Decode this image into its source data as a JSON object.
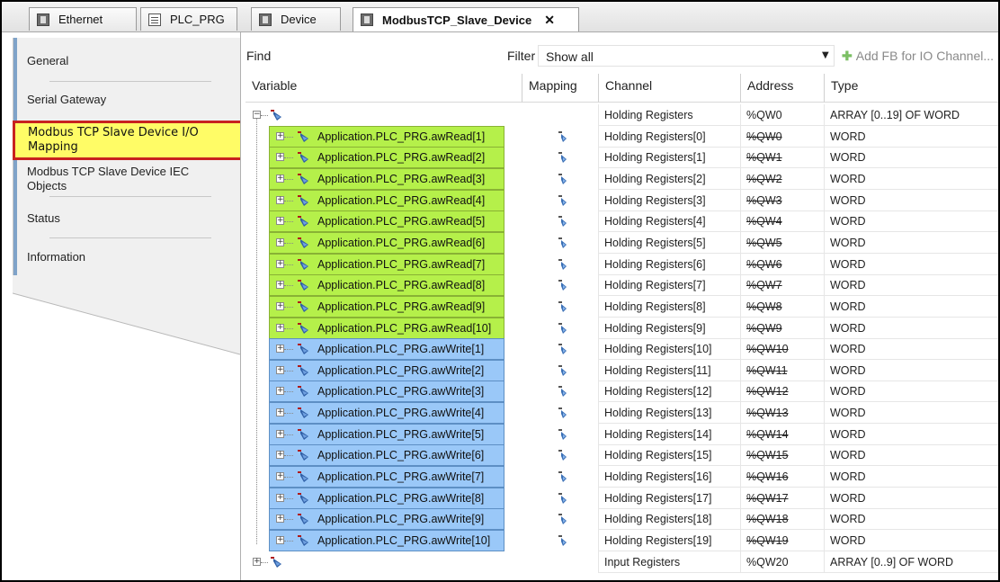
{
  "tabs": [
    {
      "label": "Ethernet",
      "icon": "device-icon"
    },
    {
      "label": "PLC_PRG",
      "icon": "document-icon"
    },
    {
      "label": "Device",
      "icon": "device-icon"
    },
    {
      "label": "ModbusTCP_Slave_Device",
      "icon": "device-icon",
      "close": "✕"
    }
  ],
  "nav": {
    "general": "General",
    "serial_gateway": "Serial Gateway",
    "io_mapping": "Modbus TCP Slave Device I/O Mapping",
    "iec_objects": "Modbus TCP Slave Device IEC Objects",
    "status": "Status",
    "information": "Information"
  },
  "toolbar": {
    "find_label": "Find",
    "filter_label": "Filter",
    "filter_value": "Show all",
    "add_fb": "Add FB for IO Channel..."
  },
  "columns": {
    "variable": "Variable",
    "mapping": "Mapping",
    "channel": "Channel",
    "address": "Address",
    "type": "Type"
  },
  "rows": [
    {
      "variable": "",
      "channel": "Holding Registers",
      "address": "%QW0",
      "type": "ARRAY [0..19] OF WORD"
    },
    {
      "variable": "Application.PLC_PRG.awRead[1]",
      "channel": "Holding Registers[0]",
      "address": "%QW0",
      "type": "WORD"
    },
    {
      "variable": "Application.PLC_PRG.awRead[2]",
      "channel": "Holding Registers[1]",
      "address": "%QW1",
      "type": "WORD"
    },
    {
      "variable": "Application.PLC_PRG.awRead[3]",
      "channel": "Holding Registers[2]",
      "address": "%QW2",
      "type": "WORD"
    },
    {
      "variable": "Application.PLC_PRG.awRead[4]",
      "channel": "Holding Registers[3]",
      "address": "%QW3",
      "type": "WORD"
    },
    {
      "variable": "Application.PLC_PRG.awRead[5]",
      "channel": "Holding Registers[4]",
      "address": "%QW4",
      "type": "WORD"
    },
    {
      "variable": "Application.PLC_PRG.awRead[6]",
      "channel": "Holding Registers[5]",
      "address": "%QW5",
      "type": "WORD"
    },
    {
      "variable": "Application.PLC_PRG.awRead[7]",
      "channel": "Holding Registers[6]",
      "address": "%QW6",
      "type": "WORD"
    },
    {
      "variable": "Application.PLC_PRG.awRead[8]",
      "channel": "Holding Registers[7]",
      "address": "%QW7",
      "type": "WORD"
    },
    {
      "variable": "Application.PLC_PRG.awRead[9]",
      "channel": "Holding Registers[8]",
      "address": "%QW8",
      "type": "WORD"
    },
    {
      "variable": "Application.PLC_PRG.awRead[10]",
      "channel": "Holding Registers[9]",
      "address": "%QW9",
      "type": "WORD"
    },
    {
      "variable": "Application.PLC_PRG.awWrite[1]",
      "channel": "Holding Registers[10]",
      "address": "%QW10",
      "type": "WORD"
    },
    {
      "variable": "Application.PLC_PRG.awWrite[2]",
      "channel": "Holding Registers[11]",
      "address": "%QW11",
      "type": "WORD"
    },
    {
      "variable": "Application.PLC_PRG.awWrite[3]",
      "channel": "Holding Registers[12]",
      "address": "%QW12",
      "type": "WORD"
    },
    {
      "variable": "Application.PLC_PRG.awWrite[4]",
      "channel": "Holding Registers[13]",
      "address": "%QW13",
      "type": "WORD"
    },
    {
      "variable": "Application.PLC_PRG.awWrite[5]",
      "channel": "Holding Registers[14]",
      "address": "%QW14",
      "type": "WORD"
    },
    {
      "variable": "Application.PLC_PRG.awWrite[6]",
      "channel": "Holding Registers[15]",
      "address": "%QW15",
      "type": "WORD"
    },
    {
      "variable": "Application.PLC_PRG.awWrite[7]",
      "channel": "Holding Registers[16]",
      "address": "%QW16",
      "type": "WORD"
    },
    {
      "variable": "Application.PLC_PRG.awWrite[8]",
      "channel": "Holding Registers[17]",
      "address": "%QW17",
      "type": "WORD"
    },
    {
      "variable": "Application.PLC_PRG.awWrite[9]",
      "channel": "Holding Registers[18]",
      "address": "%QW18",
      "type": "WORD"
    },
    {
      "variable": "Application.PLC_PRG.awWrite[10]",
      "channel": "Holding Registers[19]",
      "address": "%QW19",
      "type": "WORD"
    },
    {
      "variable": "",
      "channel": "Input Registers",
      "address": "%QW20",
      "type": "ARRAY [0..9] OF WORD"
    }
  ],
  "colors": {
    "read_highlight": "#b5f04a",
    "write_highlight": "#9ac8f8",
    "selected_nav": "#fffc66",
    "selected_nav_border": "#c8221f"
  }
}
